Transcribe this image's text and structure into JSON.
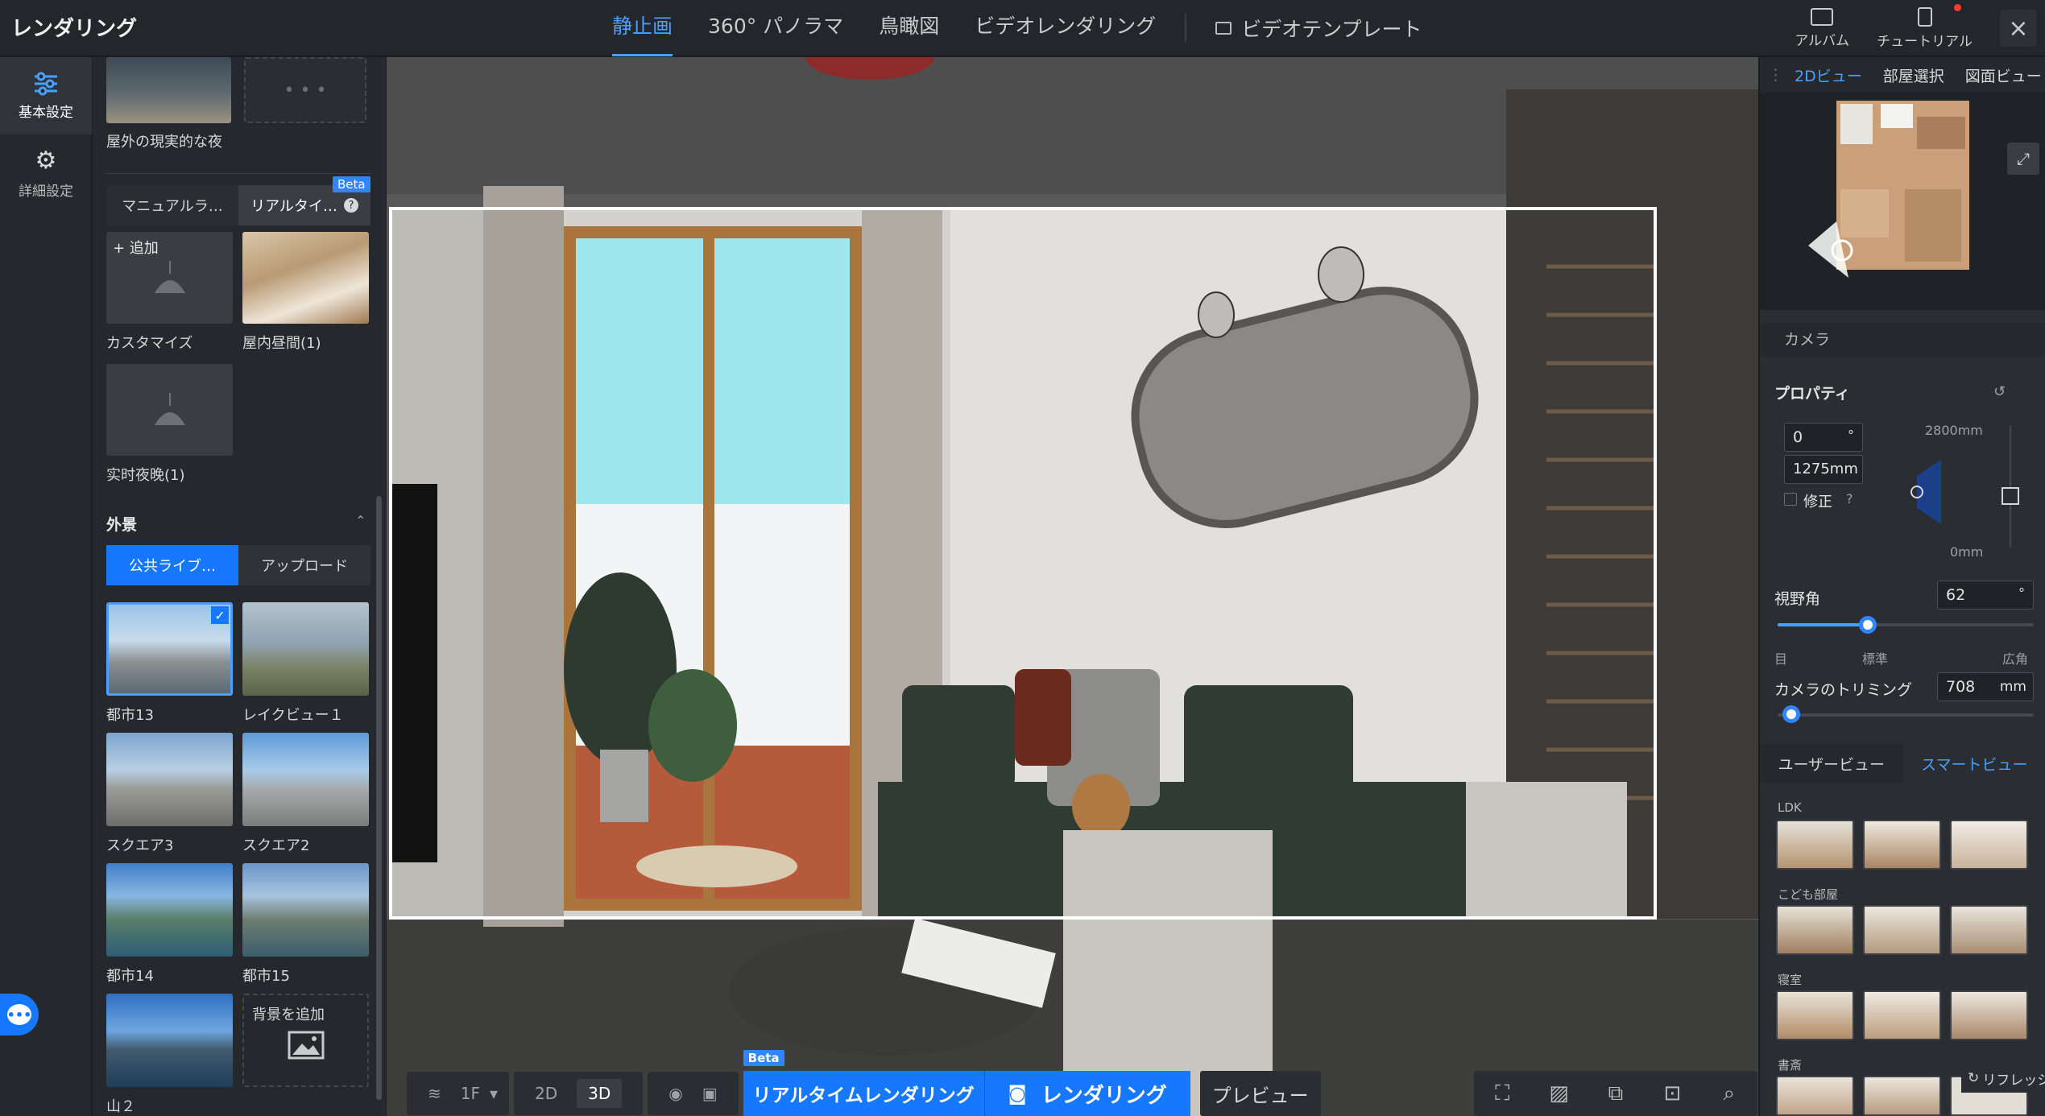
{
  "app": {
    "title": "レンダリング"
  },
  "mode_tabs": [
    "静止画",
    "360° パノラマ",
    "鳥瞰図",
    "ビデオレンダリング"
  ],
  "mode_tab_active": "静止画",
  "video_template": "ビデオテンプレート",
  "top_right": {
    "album": "アルバム",
    "tutorial": "チュートリアル",
    "close": "×"
  },
  "rail": {
    "basic": "基本設定",
    "advanced": "詳細設定"
  },
  "lighting": {
    "prev_label": "屋外の現実的な夜",
    "tabs": {
      "manual": "マニュアルラ…",
      "realtime": "リアルタイ…",
      "beta": "Beta"
    },
    "add": "+ 追加",
    "presets": [
      "カスタマイズ",
      "屋内昼間(1)",
      "实时夜晚(1)"
    ]
  },
  "background": {
    "title": "外景",
    "tabs": {
      "public": "公共ライブ…",
      "upload": "アップロード"
    },
    "items": [
      "都市13",
      "レイクビュー１",
      "スクエア3",
      "スクエア2",
      "都市14",
      "都市15",
      "山２"
    ],
    "add": "背景を追加"
  },
  "bottombar": {
    "floor": "1F",
    "mode2d": "2D",
    "mode3d": "3D",
    "beta": "Beta",
    "realtime": "リアルタイムレンダリング",
    "render": "レンダリング",
    "preview": "プレビュー"
  },
  "right": {
    "tabs": [
      "2Dビュー",
      "部屋選択",
      "図面ビュー"
    ],
    "camera_title": "カメラ",
    "properties": "プロパティ",
    "angle": "0",
    "angle_unit": "°",
    "height": "1275mm",
    "correction": "修正",
    "top_mm": "2800mm",
    "bottom_mm": "0mm",
    "fov_label": "視野角",
    "fov_value": "62",
    "fov_unit": "°",
    "fov_marks": [
      "目",
      "標準",
      "広角"
    ],
    "trim_label": "カメラのトリミング",
    "trim_value": "708",
    "trim_unit": "mm",
    "view_user": "ユーザービュー",
    "view_smart": "スマートビュー",
    "rooms": [
      "LDK",
      "こども部屋",
      "寝室",
      "書斎"
    ],
    "refresh": "リフレッシュ"
  },
  "colors": {
    "accent": "#1677ff",
    "active_text": "#4aa0ff",
    "panel": "#25282c"
  }
}
